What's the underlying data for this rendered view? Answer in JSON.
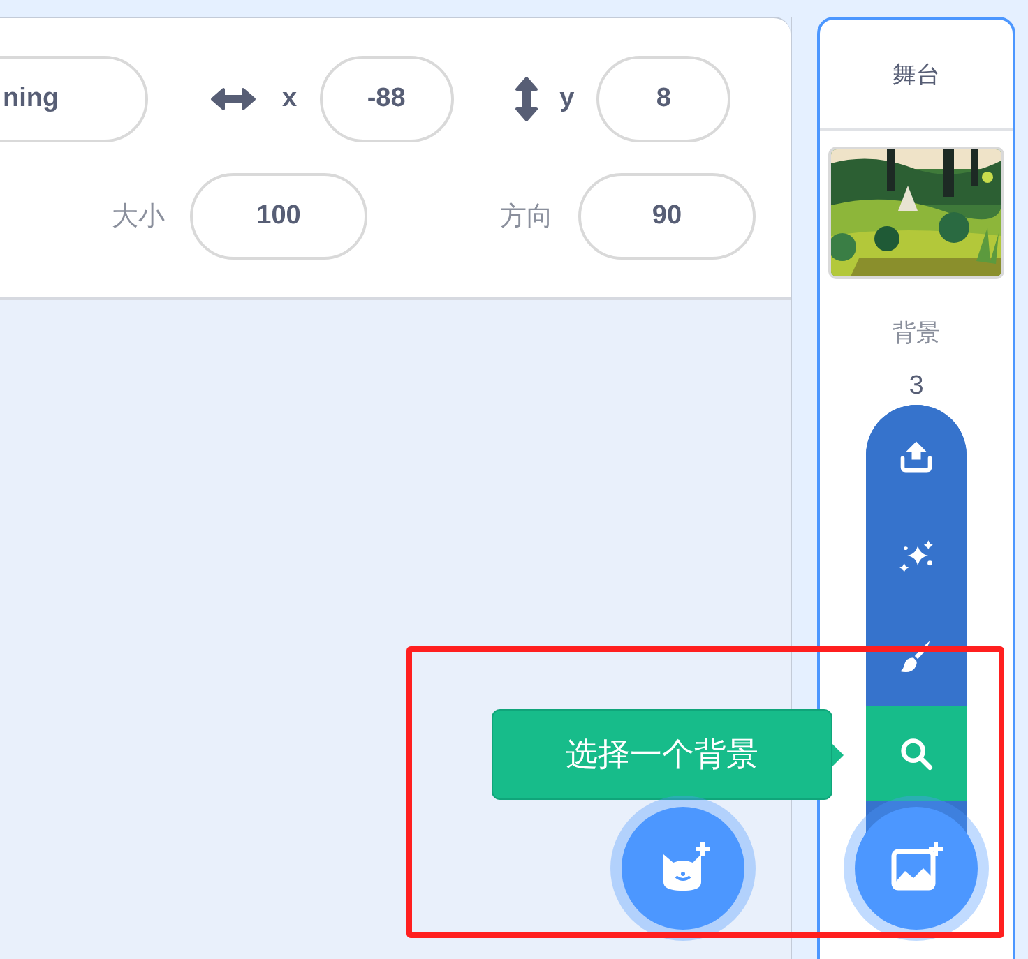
{
  "sprite_info": {
    "name": {
      "value": "ning"
    },
    "position": [
      {
        "kind": "x",
        "label": "x",
        "value": "-88"
      },
      {
        "kind": "y",
        "label": "y",
        "value": "8"
      }
    ],
    "size": {
      "label": "大小",
      "value": "100"
    },
    "direction": {
      "label": "方向",
      "value": "90"
    }
  },
  "stage": {
    "title": "舞台",
    "backdrops_label": "背景",
    "backdrops_count": "3",
    "backdrop_menu": [
      {
        "kind": "upload",
        "selected": false
      },
      {
        "kind": "surprise",
        "selected": false
      },
      {
        "kind": "paint",
        "selected": false
      },
      {
        "kind": "search",
        "selected": true
      }
    ],
    "tooltip": "选择一个背景"
  }
}
